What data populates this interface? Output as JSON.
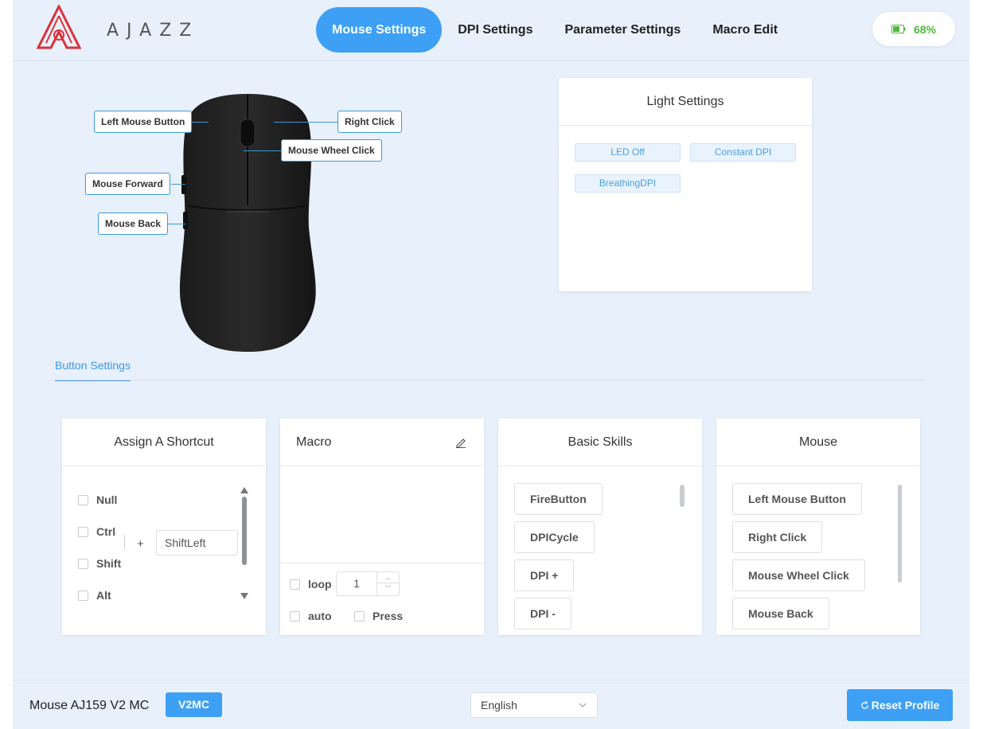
{
  "brand": {
    "name": "AJAZZ"
  },
  "nav": {
    "tabs": [
      {
        "label": "Mouse Settings",
        "active": true
      },
      {
        "label": "DPI Settings",
        "active": false
      },
      {
        "label": "Parameter Settings",
        "active": false
      },
      {
        "label": "Macro Edit",
        "active": false
      }
    ]
  },
  "battery": {
    "percent": "68%",
    "level": 0.68,
    "color": "#4db83b"
  },
  "mouse_buttons": {
    "left": "Left Mouse Button",
    "right": "Right Click",
    "wheel": "Mouse Wheel Click",
    "forward": "Mouse Forward",
    "back": "Mouse Back"
  },
  "light_settings": {
    "title": "Light Settings",
    "options": [
      "LED Off",
      "Constant DPI",
      "BreathingDPI"
    ]
  },
  "button_settings": {
    "tab_label": "Button Settings",
    "shortcut": {
      "title": "Assign A Shortcut",
      "modifiers": [
        "Null",
        "Ctrl",
        "Shift",
        "Alt"
      ],
      "plus": "+",
      "key_value": "ShiftLeft"
    },
    "macro": {
      "title": "Macro",
      "loop_label": "loop",
      "loop_count": "1",
      "auto_label": "auto",
      "press_label": "Press"
    },
    "basic_skills": {
      "title": "Basic Skills",
      "items": [
        "FireButton",
        "DPICycle",
        "DPI +",
        "DPI -"
      ]
    },
    "mouse": {
      "title": "Mouse",
      "items": [
        "Left Mouse Button",
        "Right Click",
        "Mouse Wheel Click",
        "Mouse Back"
      ]
    }
  },
  "footer": {
    "device_name": "Mouse AJ159 V2 MC",
    "version": "V2MC",
    "language": "English",
    "reset_label": "Reset Profile"
  },
  "colors": {
    "accent": "#3da0f5",
    "background": "#e8f0fb",
    "brand_red": "#d9323b",
    "callout_border": "#3c9ad8"
  }
}
